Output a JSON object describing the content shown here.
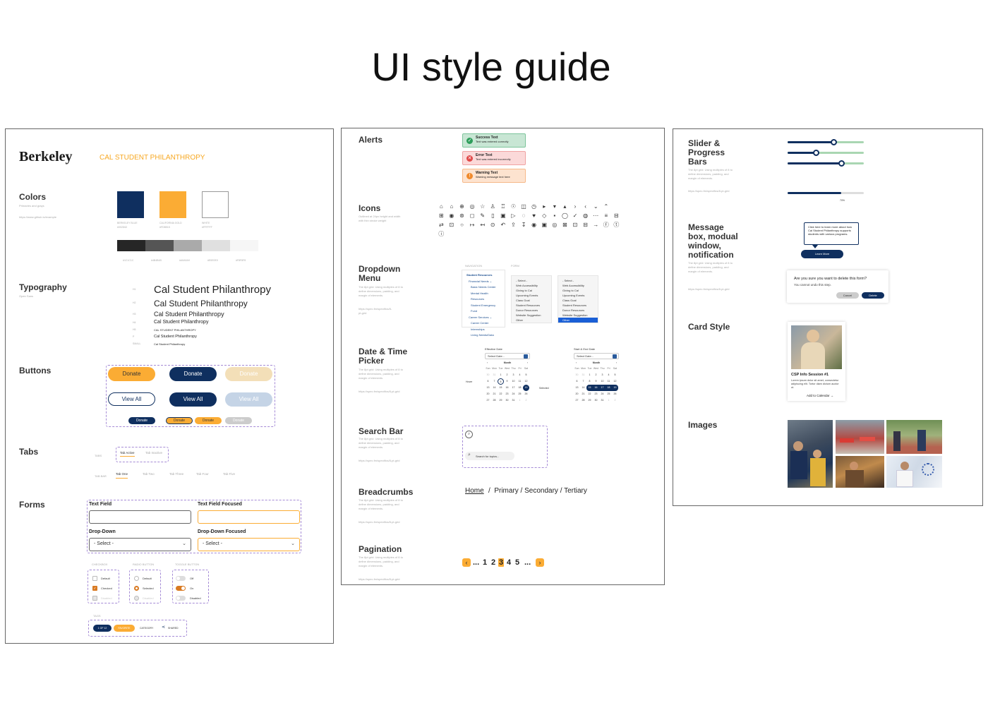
{
  "title": "UI style guide",
  "left": {
    "brand": "Berkeley",
    "subbrand": "CAL STUDENT PHILANTHROPY",
    "colors_title": "Colors",
    "colors_sub": "Primaries and grays",
    "colors_link": "https://www.github.io/example",
    "swatches": [
      {
        "name": "BERKELEY BLUE",
        "hex": "#002D62",
        "color": "#0f2f5f"
      },
      {
        "name": "CALIFORNIA GOLD",
        "hex": "#FDB515",
        "color": "#fbac34"
      },
      {
        "name": "WHITE",
        "hex": "#FFFFFF",
        "color": "#ffffff"
      }
    ],
    "grays": [
      {
        "hex": "#1C1C1C",
        "color": "#262626"
      },
      {
        "hex": "#4B4B4B",
        "color": "#555555"
      },
      {
        "hex": "#A9A9A9",
        "color": "#aaaaaa"
      },
      {
        "hex": "#E0E0E0",
        "color": "#e0e0e0"
      },
      {
        "hex": "#F8F8F8",
        "color": "#f6f6f6"
      }
    ],
    "typography_title": "Typography",
    "typography_sub": "Open Sans",
    "type_rows": [
      {
        "tag": "H1",
        "text": "Cal Student Philanthropy"
      },
      {
        "tag": "H2",
        "text": "Cal Student Philanthropy"
      },
      {
        "tag": "H3",
        "text": "Cal Student Philanthropy"
      },
      {
        "tag": "H4",
        "text": "Cal Student Philanthropy"
      },
      {
        "tag": "H5",
        "text": "CAL STUDENT PHILANTHROPY"
      },
      {
        "tag": "P",
        "text": "Cal Student Philanthropy"
      },
      {
        "tag": "SMALL",
        "text": "Cal Student Philanthropy"
      }
    ],
    "buttons_title": "Buttons",
    "btn_donate": "Donate",
    "btn_view_all": "View All",
    "tabs_title": "Tabs",
    "tabs_label1": "TABS",
    "tab_active": "Tab Active",
    "tab_inactive": "Tab Inactive",
    "tabs_label2": "TAB BAR",
    "tab_items": [
      "Tab One",
      "Tab Two",
      "Tab Three",
      "Tab Four",
      "Tab Five"
    ],
    "forms_title": "Forms",
    "text_field": "Text Field",
    "text_field_focused": "Text Field Focused",
    "dropdown": "Drop-Down",
    "dropdown_focused": "Drop-Down Focused",
    "select_placeholder": "- Select -",
    "checkbox_label": "CHECKBOX",
    "radio_label": "RADIO BUTTON",
    "toggle_label": "TOGGLE BUTTON",
    "checkbox_items": [
      "Default",
      "Checked",
      "Disabled"
    ],
    "radio_items": [
      "Default",
      "Selected",
      "Disabled"
    ],
    "toggle_items": [
      "Off",
      "On",
      "Disabled"
    ],
    "tags_label": "TAGS",
    "tag_items": [
      "1 OF 12",
      "FAVORITE",
      "CATEGORY",
      "SHARED"
    ]
  },
  "middle": {
    "desc": "The 8pt grid: Using multiples of 8 to define dimensions, padding, and margin of elements.",
    "link": "https://spec.fm/specifics/8-pt-grid",
    "alerts_title": "Alerts",
    "alerts": [
      {
        "title": "Success Text",
        "text": "Text was entered correctly",
        "bg": "#c8e6d4",
        "border": "#7cc49a",
        "icon": "#2e9e5b",
        "glyph": "✓"
      },
      {
        "title": "Error Text",
        "text": "Text was entered incorrectly",
        "bg": "#fbd9d9",
        "border": "#f0a3a3",
        "icon": "#e04848",
        "glyph": "✕"
      },
      {
        "title": "Warning Text",
        "text": "Warning message text here",
        "bg": "#fde3cf",
        "border": "#f6b98a",
        "icon": "#f08a2c",
        "glyph": "!"
      }
    ],
    "icons_title": "Icons",
    "icons_sub": "Outlined at 24px height and width with thin stroke weight",
    "icon_glyphs": [
      "⌂",
      "⌂",
      "⊕",
      "◎",
      "☆",
      "♙",
      "♖",
      "☉",
      "◫",
      "◷",
      "▸",
      "▾",
      "▴",
      "›",
      "‹",
      "⌄",
      "⌃",
      "",
      "⊞",
      "◉",
      "⊛",
      "◻",
      "✎",
      "▯",
      "▣",
      "▷",
      "◌",
      "♥",
      "◇",
      "▪",
      "◯",
      "✓",
      "◍",
      "⋯",
      "≡",
      "⊟",
      "⇄",
      "⊡",
      "○",
      "↦",
      "↤",
      "⊙",
      "↶",
      "⇪",
      "↧",
      "◉",
      "▣",
      "◎",
      "⊠",
      "⊡",
      "⊟",
      "→",
      "ⓕ",
      "ⓣ",
      "ⓘ"
    ],
    "dropdown_title": "Dropdown Menu",
    "dd_head1": "NAVIGATION",
    "dd_head2": "FORM",
    "dd_nav": [
      "Student Resources",
      "Financial Needs ⌄",
      "Basic Needs Center",
      "Mental Health Resources",
      "Student Emergency Fund",
      "Career Services ⌄",
      "Career Center",
      "Internships",
      "Living Needs/Data"
    ],
    "dd_form": [
      "- Select -",
      "Web Accessibility",
      "Giving to Cal",
      "Upcoming Events",
      "Class Goal",
      "Student Resources",
      "Donor Resources",
      "Website Suggestion",
      "Other"
    ],
    "date_title": "Date & Time Picker",
    "date_label1": "Effective Date",
    "date_label2": "Start & End Date",
    "date_placeholder": "Select Date...",
    "month": "Month",
    "hover_label": "Hover",
    "selected_label": "Selected",
    "weekdays": [
      "Sun",
      "Mon",
      "Tue",
      "Wed",
      "Thu",
      "Fri",
      "Sat"
    ],
    "days": [
      "30",
      "31",
      "1",
      "2",
      "3",
      "4",
      "5",
      "6",
      "7",
      "8",
      "9",
      "10",
      "11",
      "12",
      "13",
      "14",
      "15",
      "16",
      "17",
      "18",
      "19",
      "20",
      "21",
      "22",
      "23",
      "24",
      "25",
      "26",
      "27",
      "28",
      "29",
      "30",
      "31",
      "1",
      "2",
      "3",
      "4",
      "5"
    ],
    "search_title": "Search Bar",
    "search_placeholder": "Search for topics...",
    "breadcrumbs_title": "Breadcrumbs",
    "breadcrumb_home": "Home",
    "breadcrumb_rest": "/  Primary / Secondary / Tertiary",
    "pagination_title": "Pagination",
    "pages": [
      "...",
      "1",
      "2",
      "3",
      "4",
      "5",
      "..."
    ]
  },
  "right": {
    "slider_title": "Slider & Progress Bars",
    "slider_values": [
      0.6,
      0.37,
      0.7
    ],
    "progress": "70%",
    "progress_value": 0.7,
    "message_title": "Message box, modual window, notification",
    "tooltip_text": "Click here to learn more about how Cal Student Philanthropy supports students with various programs.",
    "learn_more": "Learn More",
    "modal_title": "Are you sure you want to delete this form?",
    "modal_sub": "You cannot undo this step.",
    "cancel": "Cancel",
    "delete": "Delete",
    "card_title": "Card Style",
    "card_heading": "CSP Info Session #1",
    "card_body": "Lorem ipsum dolor sit amet, consectetur adipiscing elit. Tortor diam dictum auctor ut.",
    "card_link": "Add to Calendar",
    "images_title": "Images"
  }
}
